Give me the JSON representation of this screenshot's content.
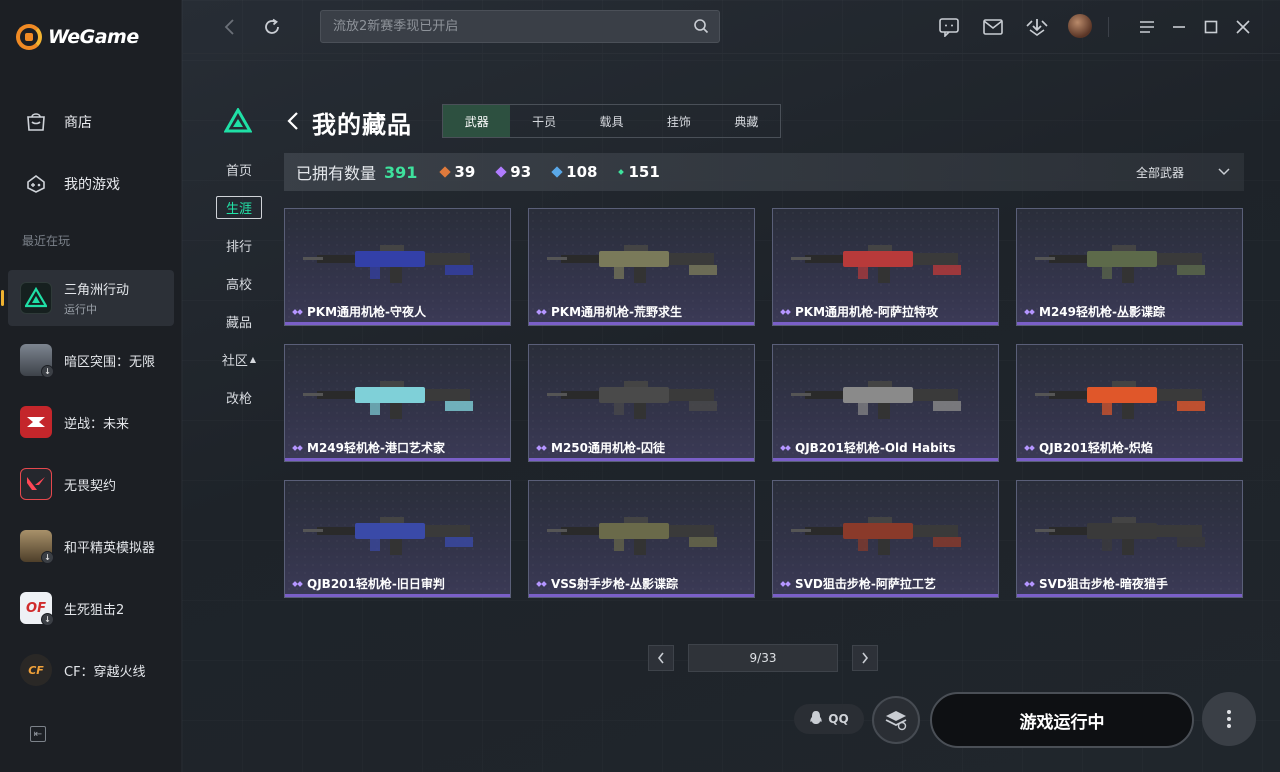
{
  "app": {
    "name": "WeGame"
  },
  "sidebar": {
    "nav": [
      {
        "label": "商店",
        "icon": "shop-bag-icon"
      },
      {
        "label": "我的游戏",
        "icon": "gamepad-icon"
      }
    ],
    "recent_label": "最近在玩",
    "recent": [
      {
        "name": "三角洲行动",
        "status": "运行中",
        "icon": "delta-force-icon",
        "color": "#1e2a2a"
      },
      {
        "name": "暗区突围：无限",
        "icon": "arena-breakout-icon",
        "color": "#5b6470"
      },
      {
        "name": "逆战：未来",
        "icon": "nizhan-icon",
        "color": "#c4262b"
      },
      {
        "name": "无畏契约",
        "icon": "valorant-icon",
        "color": "#2b2d33"
      },
      {
        "name": "和平精英模拟器",
        "icon": "pubg-simulator-icon",
        "color": "#6d5a3c"
      },
      {
        "name": "生死狙击2",
        "icon": "sniper2-icon",
        "color": "#d8dde6"
      },
      {
        "name": "CF：穿越火线",
        "icon": "crossfire-icon",
        "color": "#3c3a38"
      }
    ]
  },
  "topbar": {
    "search_placeholder": "流放2新赛季现已开启"
  },
  "game_nav": {
    "items": [
      "首页",
      "生涯",
      "排行",
      "高校",
      "藏品",
      "社区",
      "改枪"
    ],
    "active": "生涯"
  },
  "collection": {
    "title": "我的藏品",
    "tabs": [
      "武器",
      "干员",
      "载具",
      "挂饰",
      "典藏"
    ],
    "active_tab": "武器",
    "owned_label": "已拥有数量",
    "owned_total": "391",
    "rarity_counts": [
      {
        "value": "39",
        "color": "#e07a3c"
      },
      {
        "value": "93",
        "color": "#b07cff"
      },
      {
        "value": "108",
        "color": "#5aa8e8"
      },
      {
        "value": "151",
        "color": "#3ee29d"
      }
    ],
    "filter_label": "全部武器",
    "items": [
      {
        "name": "PKM通用机枪-守夜人",
        "accent": "#3340a8"
      },
      {
        "name": "PKM通用机枪-荒野求生",
        "accent": "#7a7a5a"
      },
      {
        "name": "PKM通用机枪-阿萨拉特攻",
        "accent": "#b83a3a"
      },
      {
        "name": "M249轻机枪-丛影谍踪",
        "accent": "#5d6a4a"
      },
      {
        "name": "M249轻机枪-港口艺术家",
        "accent": "#7fd0d8"
      },
      {
        "name": "M250通用机枪-囚徒",
        "accent": "#4a4a4a"
      },
      {
        "name": "QJB201轻机枪-Old Habits",
        "accent": "#8a8a8a"
      },
      {
        "name": "QJB201轻机枪-炽焰",
        "accent": "#e0572a"
      },
      {
        "name": "QJB201轻机枪-旧日审判",
        "accent": "#3a4aa8"
      },
      {
        "name": "VSS射手步枪-丛影谍踪",
        "accent": "#6a6a4a"
      },
      {
        "name": "SVD狙击步枪-阿萨拉工艺",
        "accent": "#8a3a2a"
      },
      {
        "name": "SVD狙击步枪-暗夜猎手",
        "accent": "#3a3a3a"
      }
    ],
    "pagination": "9/33"
  },
  "bottom": {
    "qq_label": "QQ",
    "run_label": "游戏运行中"
  }
}
